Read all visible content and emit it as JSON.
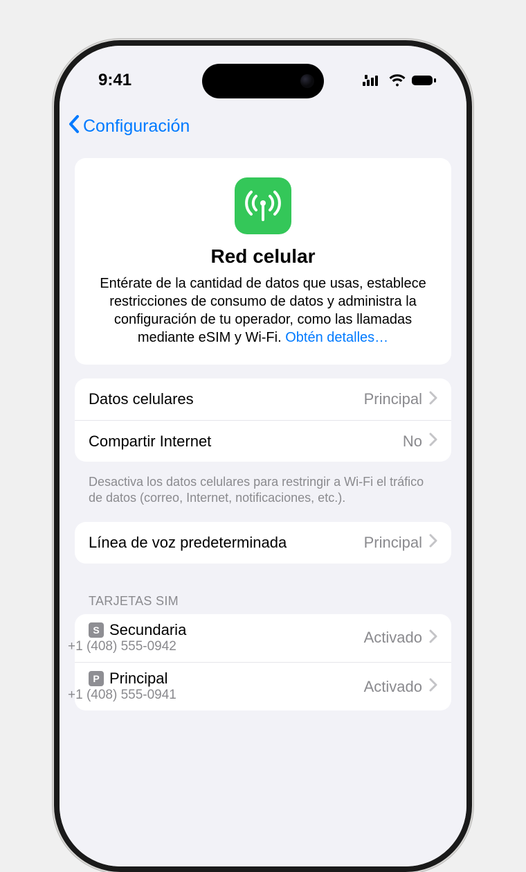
{
  "status": {
    "time": "9:41"
  },
  "nav": {
    "back_label": "Configuración"
  },
  "hero": {
    "title": "Red celular",
    "description": "Entérate de la cantidad de datos que usas, establece restricciones de consumo de datos y administra la configuración de tu operador, como las llamadas mediante eSIM y Wi-Fi. ",
    "link_text": "Obtén detalles…"
  },
  "rows": {
    "cellular_data": {
      "label": "Datos celulares",
      "value": "Principal"
    },
    "hotspot": {
      "label": "Compartir Internet",
      "value": "No"
    },
    "voice_line": {
      "label": "Línea de voz predeterminada",
      "value": "Principal"
    }
  },
  "footer_note": "Desactiva los datos celulares para restringir a Wi-Fi el tráfico de datos (correo, Internet, notificaciones, etc.).",
  "sims_header": "TARJETAS SIM",
  "sims": [
    {
      "badge": "S",
      "name": "Secundaria",
      "number": "+1 (408) 555-0942",
      "status": "Activado"
    },
    {
      "badge": "P",
      "name": "Principal",
      "number": "+1 (408) 555-0941",
      "status": "Activado"
    }
  ]
}
